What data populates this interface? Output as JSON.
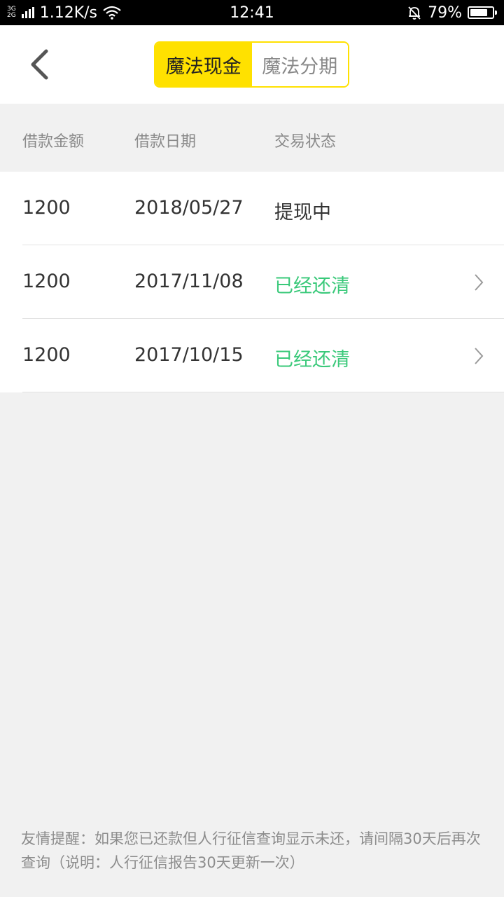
{
  "status_bar": {
    "net_type_top": "3G",
    "net_type_bottom": "2G",
    "speed": "1.12K/s",
    "time": "12:41",
    "battery": "79%",
    "battery_level": 0.79
  },
  "header": {
    "tabs": [
      {
        "label": "魔法现金",
        "active": true
      },
      {
        "label": "魔法分期",
        "active": false
      }
    ]
  },
  "columns": [
    "借款金额",
    "借款日期",
    "交易状态"
  ],
  "rows": [
    {
      "amount": "1200",
      "date": "2018/05/27",
      "status": "提现中",
      "status_type": "pending",
      "has_chevron": false
    },
    {
      "amount": "1200",
      "date": "2017/11/08",
      "status": "已经还清",
      "status_type": "paid",
      "has_chevron": true
    },
    {
      "amount": "1200",
      "date": "2017/10/15",
      "status": "已经还清",
      "status_type": "paid",
      "has_chevron": true
    }
  ],
  "notice": "友情提醒：如果您已还款但人行征信查询显示未还，请间隔30天后再次查询（说明：人行征信报告30天更新一次）",
  "colors": {
    "accent": "#ffe100",
    "paid": "#3ac97a"
  }
}
